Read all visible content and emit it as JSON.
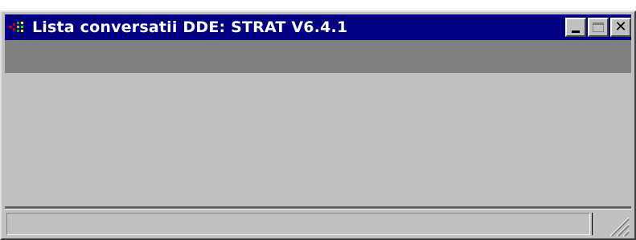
{
  "window": {
    "title": "Lista conversatii DDE: STRAT V6.4.1",
    "icon": "app-icon",
    "controls": {
      "minimize_icon": "minimize-icon",
      "maximize_icon": "maximize-icon",
      "close_label": "✕"
    }
  },
  "status_bar": {
    "text": ""
  },
  "colors": {
    "title_bar": "#000080",
    "title_text": "#ffffff",
    "face": "#c0c0c0",
    "toolbar_band": "#808080"
  }
}
